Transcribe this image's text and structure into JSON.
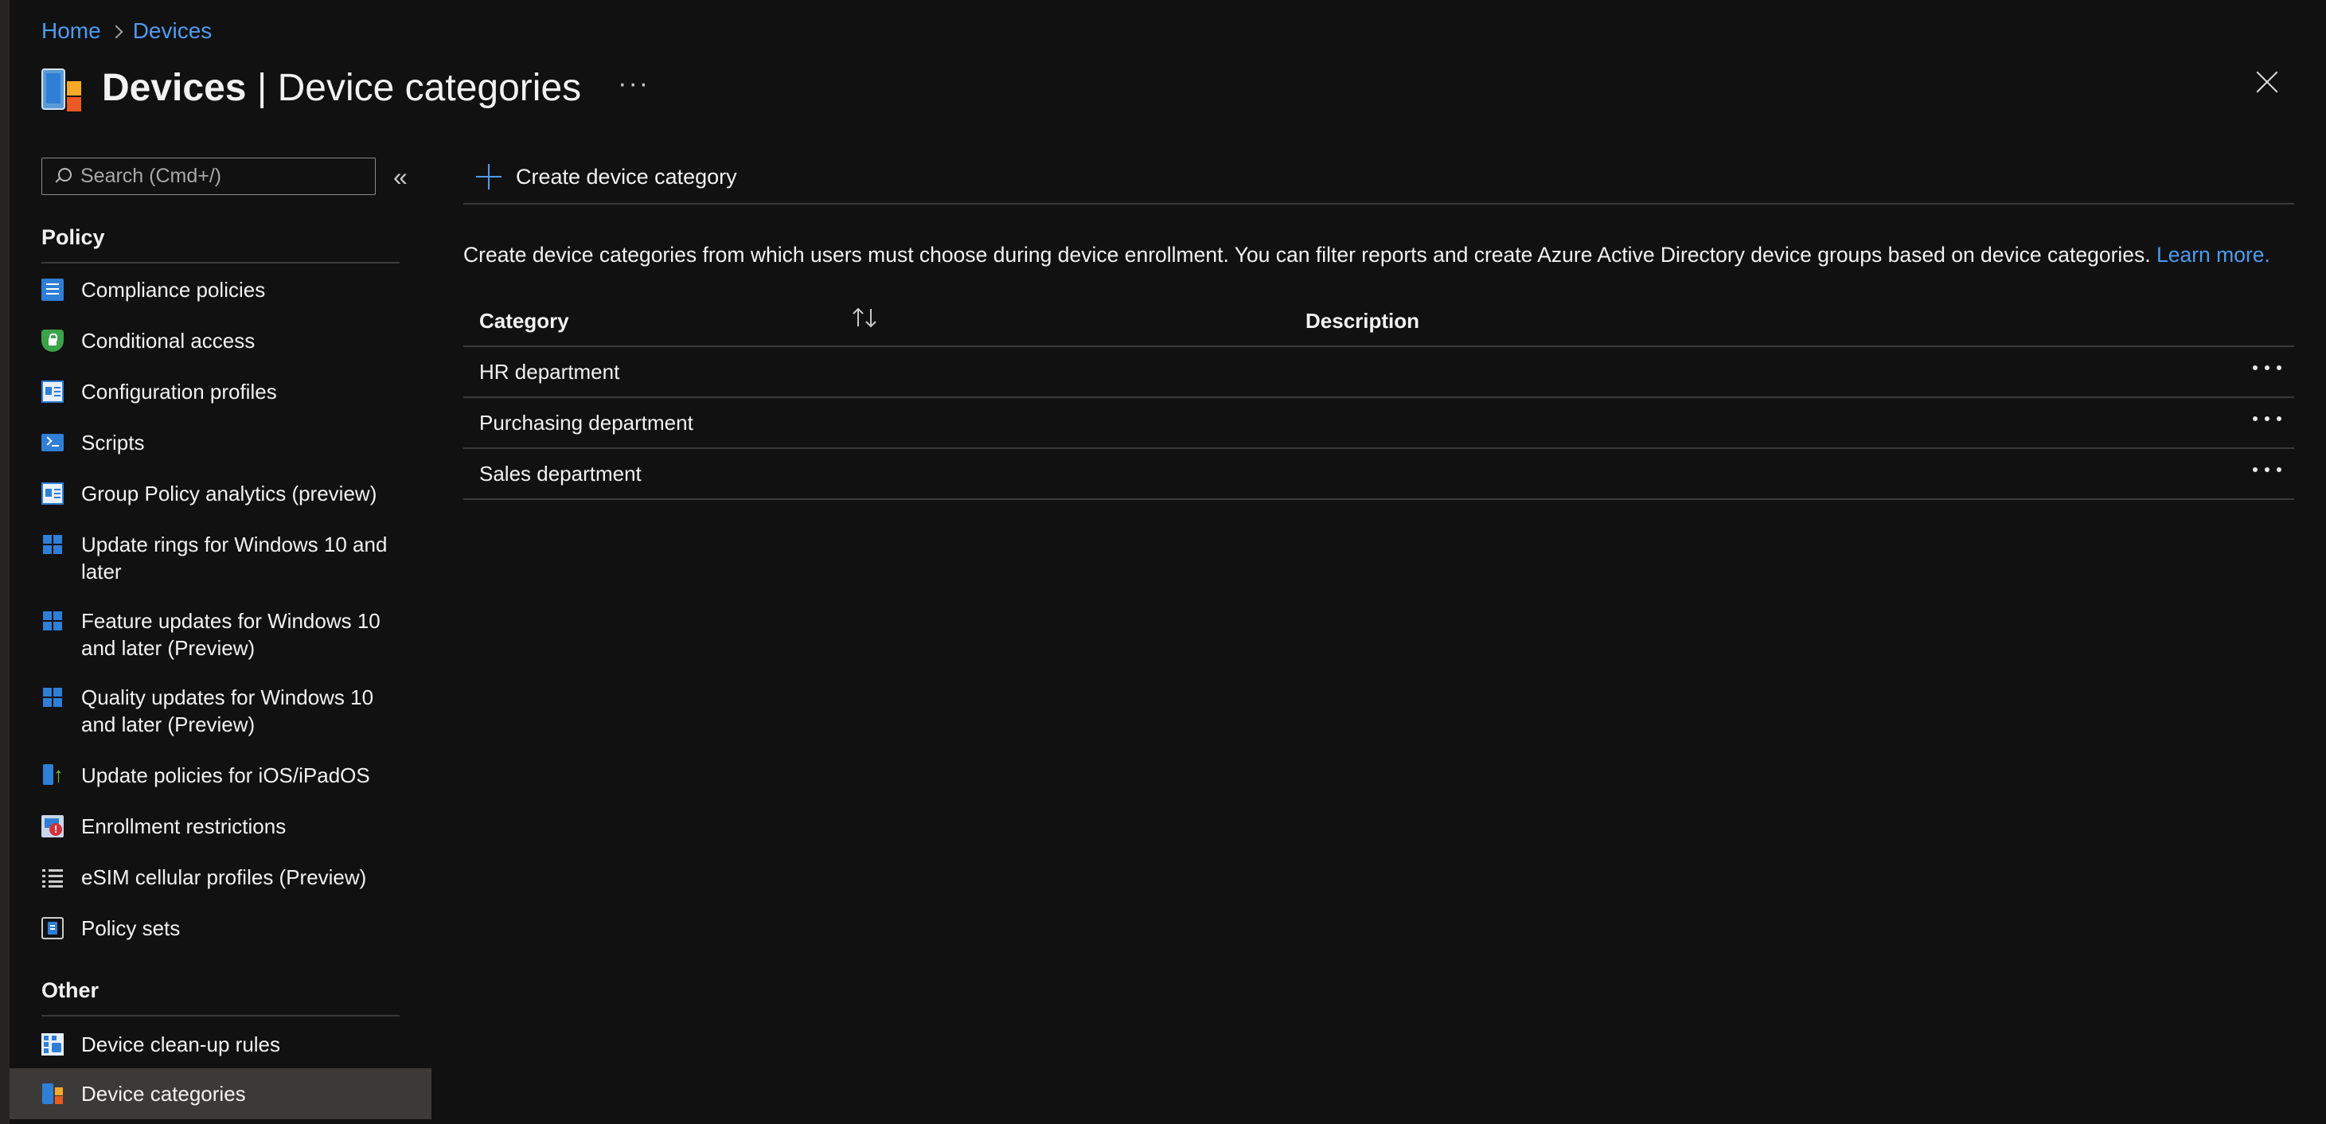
{
  "breadcrumb": {
    "home": "Home",
    "devices": "Devices"
  },
  "header": {
    "title_bold": "Devices",
    "title_rest": " | Device categories",
    "more": "···"
  },
  "sidebar": {
    "search_placeholder": "Search (Cmd+/)",
    "collapse": "«",
    "sections": [
      {
        "title": "Policy",
        "items": [
          {
            "label": "Compliance policies",
            "icon": "document-icon"
          },
          {
            "label": "Conditional access",
            "icon": "shield-lock-icon"
          },
          {
            "label": "Configuration profiles",
            "icon": "configuration-icon"
          },
          {
            "label": "Scripts",
            "icon": "script-icon"
          },
          {
            "label": "Group Policy analytics (preview)",
            "icon": "configuration-icon"
          },
          {
            "label": "Update rings for Windows 10 and later",
            "icon": "windows-icon"
          },
          {
            "label": "Feature updates for Windows 10 and later (Preview)",
            "icon": "windows-icon"
          },
          {
            "label": "Quality updates for Windows 10 and later (Preview)",
            "icon": "windows-icon"
          },
          {
            "label": "Update policies for iOS/iPadOS",
            "icon": "phone-update-icon"
          },
          {
            "label": "Enrollment restrictions",
            "icon": "enrollment-restriction-icon"
          },
          {
            "label": "eSIM cellular profiles (Preview)",
            "icon": "list-icon"
          },
          {
            "label": "Policy sets",
            "icon": "policy-set-icon"
          }
        ]
      },
      {
        "title": "Other",
        "items": [
          {
            "label": "Device clean-up rules",
            "icon": "cleanup-rules-icon"
          },
          {
            "label": "Device categories",
            "icon": "device-categories-icon",
            "selected": true
          }
        ]
      }
    ]
  },
  "toolbar": {
    "create_label": "Create device category"
  },
  "description": {
    "text": "Create device categories from which users must choose during device enrollment. You can filter reports and create Azure Active Directory device groups based on device categories. ",
    "link": "Learn more."
  },
  "table": {
    "columns": {
      "category": "Category",
      "description": "Description"
    },
    "rows": [
      {
        "category": "HR department",
        "description": ""
      },
      {
        "category": "Purchasing department",
        "description": ""
      },
      {
        "category": "Sales department",
        "description": ""
      }
    ]
  },
  "colors": {
    "accent": "#4f9bf0",
    "background": "#111111",
    "selected": "#3b3a39"
  }
}
